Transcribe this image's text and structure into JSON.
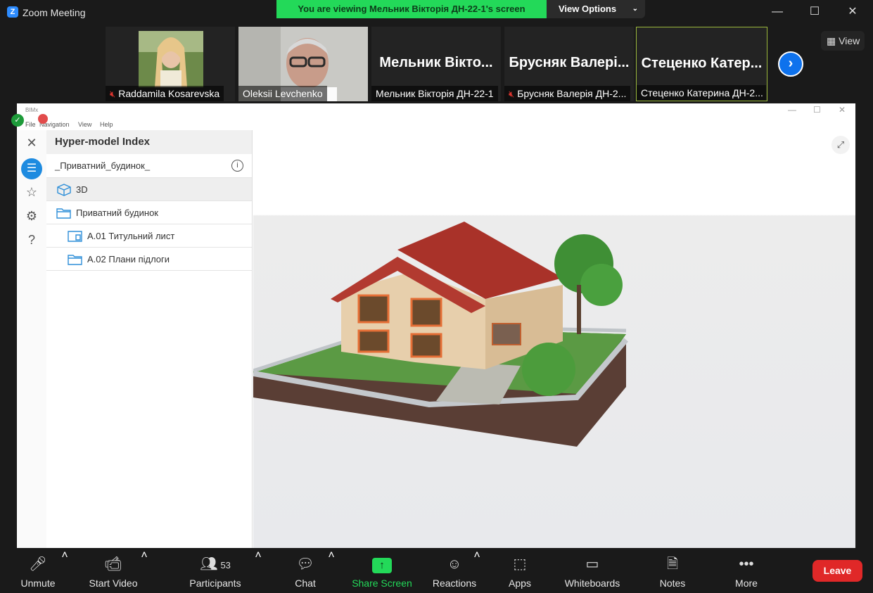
{
  "window": {
    "title": "Zoom Meeting"
  },
  "banner": {
    "text": "You are viewing Мельник Вікторія ДН-22-1's screen",
    "view_options": "View Options"
  },
  "gallery": {
    "tiles": [
      {
        "name": "Raddamila Kosarevska",
        "muted": true,
        "video": true
      },
      {
        "name": "Oleksii Levchenko",
        "muted": false,
        "video": true
      },
      {
        "big_name": "Мельник Вікто...",
        "name": "Мельник Вікторія ДН-22-1",
        "muted": false,
        "video": false
      },
      {
        "big_name": "Брусняк Валері...",
        "name": "Брусняк Валерія ДН-2...",
        "muted": true,
        "video": false
      },
      {
        "big_name": "Стеценко Катер...",
        "name": "Стеценко Катерина ДН-2...",
        "muted": false,
        "video": false,
        "active": true
      }
    ],
    "view_label": "View"
  },
  "bimx": {
    "title": "BIMx",
    "menu": [
      "File",
      "Navigation",
      "View",
      "Help"
    ],
    "panel_title": "Hyper-model Index",
    "project_name": "_Приватний_будинок_",
    "tree": [
      {
        "label": "3D",
        "icon": "cube-icon",
        "level": 0,
        "selected": true
      },
      {
        "label": "Приватний будинок",
        "icon": "folder-icon",
        "level": 0,
        "selected": false
      },
      {
        "label": "A.01 Титульний лист",
        "icon": "layout-icon",
        "level": 1,
        "selected": false
      },
      {
        "label": "A.02 Плани підлоги",
        "icon": "folder-icon",
        "level": 1,
        "selected": false
      }
    ]
  },
  "toolbar": {
    "unmute": "Unmute",
    "start_video": "Start Video",
    "participants": "Participants",
    "participants_count": "53",
    "chat": "Chat",
    "share_screen": "Share Screen",
    "reactions": "Reactions",
    "apps": "Apps",
    "whiteboards": "Whiteboards",
    "notes": "Notes",
    "more": "More",
    "leave": "Leave"
  },
  "colors": {
    "share_green": "#23d959",
    "leave_red": "#e02828",
    "zoom_blue": "#0e72ed",
    "bimx_blue": "#1e8be0"
  }
}
